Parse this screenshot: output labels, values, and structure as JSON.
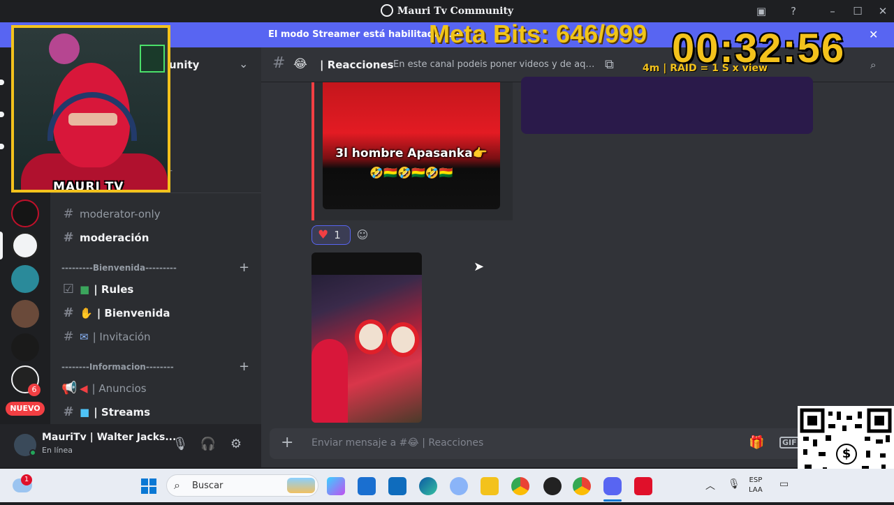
{
  "window": {
    "title": "Mauri Tv Community"
  },
  "banner": {
    "text": "El modo Streamer está habilitado. Los"
  },
  "overlay": {
    "meta_bits": "Meta Bits: 646/999",
    "timer": "00:32:56",
    "raid": "4m | RAID = 1 S x view",
    "cam_brand": "MAURI TV"
  },
  "server": {
    "name": "unity"
  },
  "sidebar": {
    "partial_label": "or",
    "channels_top": [
      {
        "label": "moderator-only",
        "icon": "hash-icon"
      },
      {
        "label": "moderación",
        "icon": "hash-icon"
      }
    ],
    "category_bienvenida": "---------Bienvenida---------",
    "bienvenida_channels": [
      {
        "label": "| Rules",
        "icon": "rules-icon"
      },
      {
        "label": "| Bienvenida",
        "icon": "hash-icon"
      },
      {
        "label": "| Invitación",
        "icon": "hash-icon"
      }
    ],
    "category_informacion": "--------Informacion--------",
    "informacion_channels": [
      {
        "label": "| Anuncios",
        "icon": "megaphone-icon"
      },
      {
        "label": "| Streams",
        "icon": "hash-icon"
      }
    ],
    "nuevo_badge": "NUEVO",
    "server_badge": "6"
  },
  "user": {
    "name": "MauriTv | Walter Jacks...",
    "status": "En línea"
  },
  "channel": {
    "name": "| Reacciones",
    "topic": "En este canal podeis poner videos y de aquí yo..."
  },
  "messages": {
    "media_caption": "3l hombre Apasanka👉",
    "media_emojis": "🤣🇧🇴🤣🇧🇴🤣🇧🇴",
    "reaction_count": "1"
  },
  "composer": {
    "placeholder": "Enviar mensaje a #😂 | Reacciones",
    "gif_label": "GIF"
  },
  "taskbar": {
    "search_placeholder": "Buscar",
    "lang_line1": "ESP",
    "lang_line2": "LAA",
    "weather_badge": "1"
  },
  "colors": {
    "accent": "#5865f2",
    "overlay_yellow": "#f3c21c",
    "danger": "#f23f43"
  }
}
